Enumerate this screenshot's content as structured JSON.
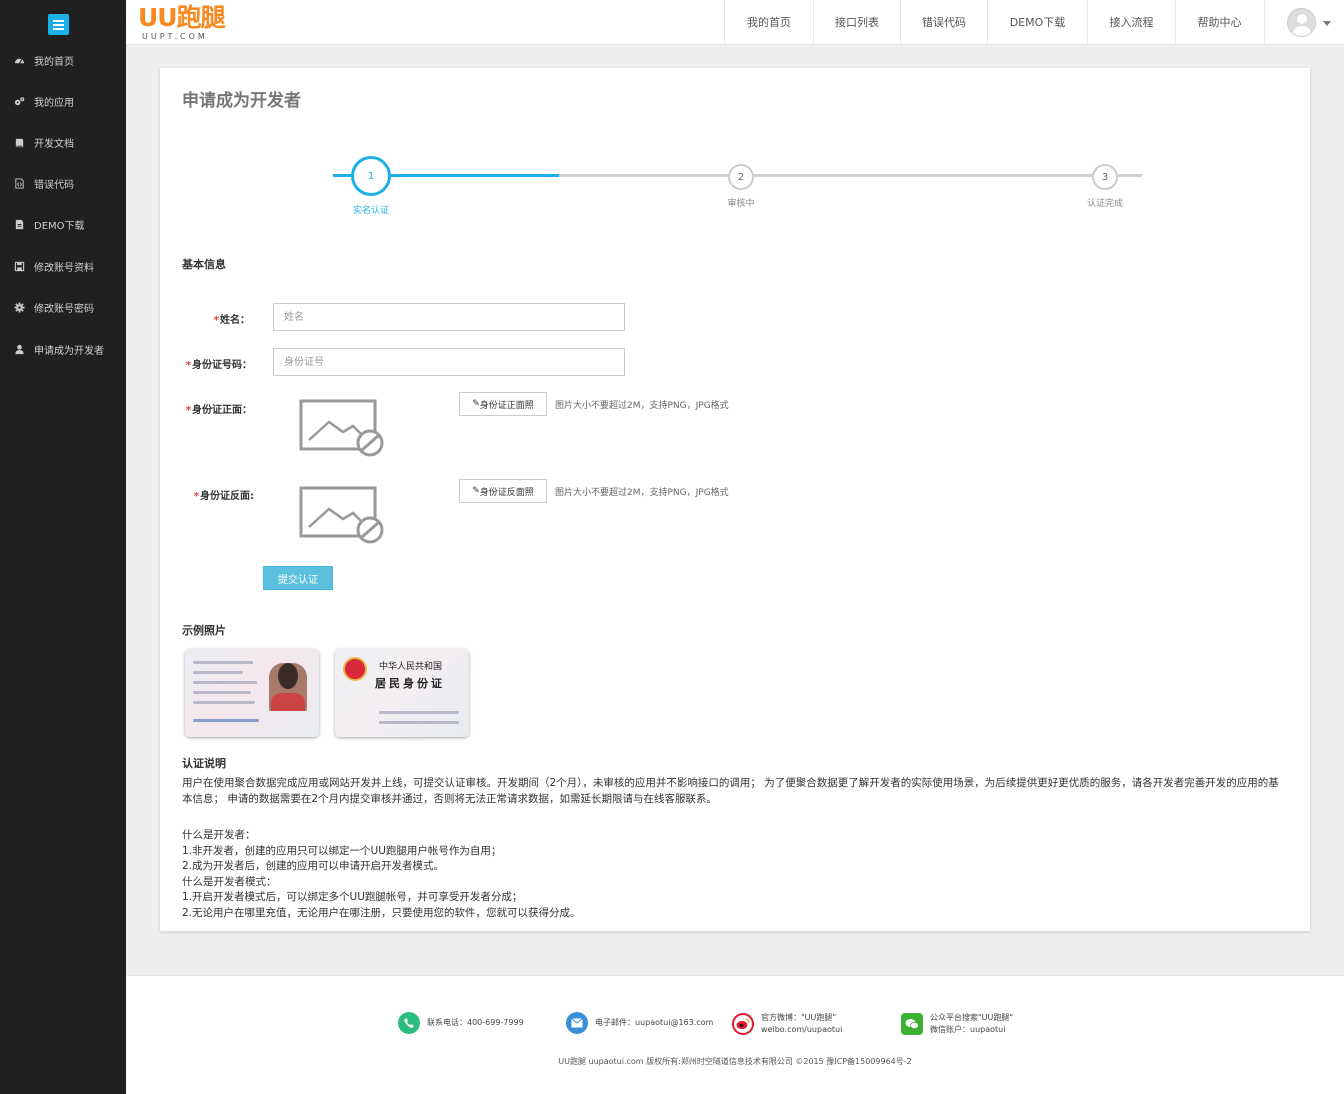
{
  "sidebar": {
    "items": [
      {
        "label": "我的首页",
        "icon": "dashboard-icon"
      },
      {
        "label": "我的应用",
        "icon": "gears-icon"
      },
      {
        "label": "开发文档",
        "icon": "book-icon"
      },
      {
        "label": "错误代码",
        "icon": "file-code-icon"
      },
      {
        "label": "DEMO下载",
        "icon": "file-download-icon"
      },
      {
        "label": "修改账号资料",
        "icon": "save-icon"
      },
      {
        "label": "修改账号密码",
        "icon": "gear-icon"
      },
      {
        "label": "申请成为开发者",
        "icon": "user-icon"
      }
    ]
  },
  "header": {
    "logo_main": "UU跑腿",
    "logo_sub": "UUPT.COM",
    "nav": [
      "我的首页",
      "接口列表",
      "错误代码",
      "DEMO下载",
      "接入流程",
      "帮助中心"
    ]
  },
  "page": {
    "title": "申请成为开发者",
    "steps": [
      {
        "num": "1",
        "label": "实名认证"
      },
      {
        "num": "2",
        "label": "审核中"
      },
      {
        "num": "3",
        "label": "认证完成"
      }
    ],
    "basic_info_title": "基本信息",
    "form": {
      "name_label": "姓名：",
      "name_placeholder": "姓名",
      "id_label": "身份证号码：",
      "id_placeholder": "身份证号",
      "front_label": "身份证正面：",
      "front_button": "身份证正面照",
      "back_label": "身份证反面:",
      "back_button": "身份证反面照",
      "hint": "图片大小不要超过2M，支持PNG，JPG格式",
      "submit": "提交认证"
    },
    "example_title": "示例照片",
    "cards": {
      "back_title": "中华人民共和国",
      "back_big": "居民身份证"
    },
    "note_title": "认证说明",
    "note_para": "用户在使用聚合数据完成应用或网站开发并上线，可提交认证审核。开发期间（2个月），未审核的应用并不影响接口的调用； 为了便聚合数据更了解开发者的实际使用场景，为后续提供更好更优质的服务，请各开发者完善开发的应用的基本信息； 申请的数据需要在2个月内提交审核并通过，否则将无法正常请求数据，如需延长期限请与在线客服联系。",
    "note_lines": [
      "什么是开发者：",
      "1.非开发者，创建的应用只可以绑定一个UU跑腿用户帐号作为自用；",
      "2.成为开发者后，创建的应用可以申请开启开发者模式。",
      "什么是开发者模式：",
      "1.开启开发者模式后，可以绑定多个UU跑腿帐号，并可享受开发者分成；",
      "2.无论用户在哪里充值，无论用户在哪注册，只要使用您的软件，您就可以获得分成。"
    ]
  },
  "footer": {
    "phone": "联系电话：400-699-7999",
    "email": "电子邮件：uupaotui@163.com",
    "weibo_1": "官方微博：\"UU跑腿\"",
    "weibo_2": "weibo.com/uupaotui",
    "wechat_1": "公众平台搜索\"UU跑腿\"",
    "wechat_2": "微信账户：uupaotui",
    "copyright": "UU跑腿 uupaotui.com 版权所有:郑州时空隧道信息技术有限公司 ©2015 豫ICP备15009964号-2"
  },
  "colors": {
    "accent": "#1bb0e8",
    "sidebar_bg": "#202020",
    "logo": "#f7891f",
    "submit": "#5bc0de"
  }
}
